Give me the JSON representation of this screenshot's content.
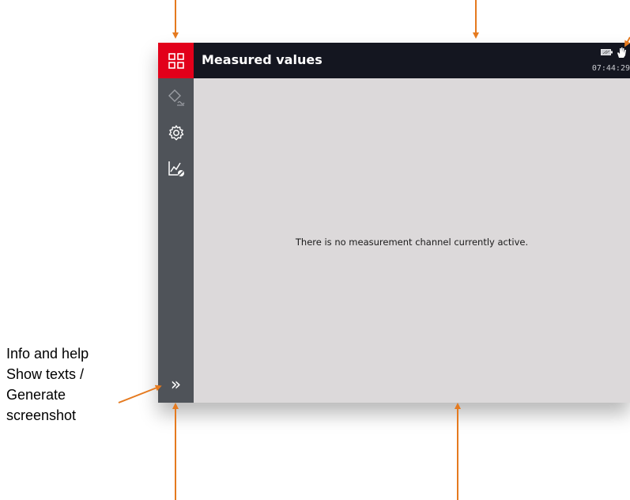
{
  "app": {
    "title": "Measured values",
    "clock": "07:44:29",
    "empty_message": "There is no measurement channel currently active."
  },
  "sidebar": {
    "items": [
      {
        "name": "menu-grid-icon",
        "active": true
      },
      {
        "name": "measurement-channel-icon",
        "active": false
      },
      {
        "name": "settings-gear-icon",
        "active": false
      },
      {
        "name": "chart-disabled-icon",
        "active": false
      }
    ],
    "expand_glyph": "»"
  },
  "status_icons": [
    "battery-icon",
    "hand-icon"
  ],
  "annotation": {
    "lines": [
      "Info and help",
      "Show texts /",
      "Generate",
      "screenshot"
    ]
  },
  "colors": {
    "accent_red": "#e2001a",
    "sidebar": "#4f5359",
    "topbar": "#141620",
    "content_bg": "#dcd9da",
    "arrow": "#e57a1f"
  }
}
